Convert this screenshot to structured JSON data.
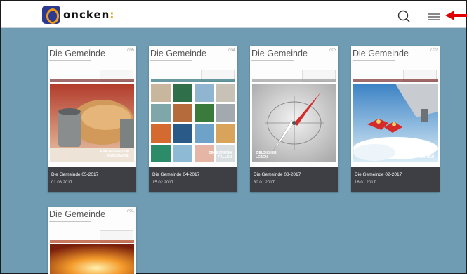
{
  "header": {
    "logo_text": "oncken",
    "logo_colon": ":",
    "search_icon": "search-icon",
    "menu_icon": "hamburger-menu-icon"
  },
  "issues": [
    {
      "cover_title": "Die Gemeinde",
      "cover_issue": "05",
      "overlay": "EINKAUFEN ZUM ABENDMAHL",
      "title": "Die Gemeinde 05-2017",
      "date": "01.03.2017"
    },
    {
      "cover_title": "Die Gemeinde",
      "cover_issue": "04",
      "overlay": "BEGEGNUNG FALLEN",
      "title": "Die Gemeinde 04-2017",
      "date": "15.02.2017"
    },
    {
      "cover_title": "Die Gemeinde",
      "cover_issue": "03",
      "overlay": "ZIELSICHER LEBEN",
      "title": "Die Gemeinde 03-2017",
      "date": "30.01.2017"
    },
    {
      "cover_title": "Die Gemeinde",
      "cover_issue": "02",
      "overlay": "VERTRAUEN LERNEN",
      "title": "Die Gemeinde 02-2017",
      "date": "16.01.2017"
    },
    {
      "cover_title": "Die Gemeinde",
      "cover_issue": "01",
      "overlay": "",
      "title": "",
      "date": ""
    }
  ],
  "colors": {
    "background": "#6f9cb2",
    "info_bar": "#3d3f45",
    "arrow": "#e00000"
  }
}
